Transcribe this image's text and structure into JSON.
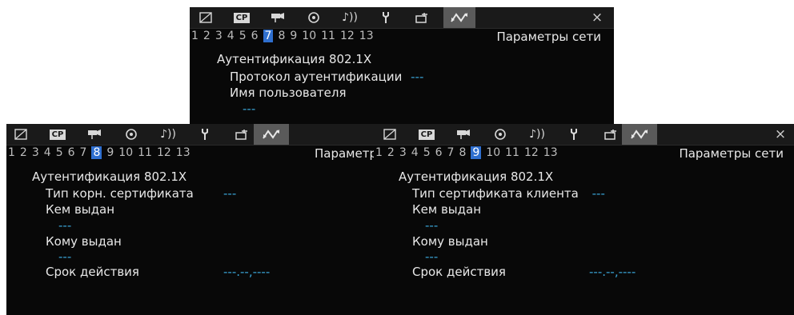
{
  "colors": {
    "background": "#080808",
    "tabbar": "#1a1a1a",
    "active_tab": "#5a5a5a",
    "selected_page": "#2f6fcf",
    "value": "#3aa6d9"
  },
  "tab_icons": [
    "screen-icon",
    "cp-icon",
    "camera-icon",
    "recording-media-icon",
    "audio-icon",
    "wrench-icon",
    "assist-icon",
    "network-icon"
  ],
  "cp_label": "CP",
  "close_symbol": "×",
  "screens": {
    "top": {
      "page_numbers": [
        "1",
        "2",
        "3",
        "4",
        "5",
        "6",
        "7",
        "8",
        "9",
        "10",
        "11",
        "12",
        "13"
      ],
      "selected_page": "7",
      "title": "Параметры сети",
      "heading": "Аутентификация 802.1X",
      "lines": {
        "protocol_label": "Протокол аутентификации",
        "protocol_value": "---",
        "username_label": "Имя пользователя",
        "username_value": "---"
      }
    },
    "left": {
      "page_numbers": [
        "1",
        "2",
        "3",
        "4",
        "5",
        "6",
        "7",
        "8",
        "9",
        "10",
        "11",
        "12",
        "13"
      ],
      "selected_page": "8",
      "title": "Параметр",
      "heading": "Аутентификация 802.1X",
      "lines": {
        "cert_type_label": "Тип корн. сертификата",
        "cert_type_value": "---",
        "issued_by_label": "Кем выдан",
        "issued_by_value": "---",
        "issued_to_label": "Кому выдан",
        "issued_to_value": "---",
        "validity_label": "Срок действия",
        "validity_value": "---.--,----"
      }
    },
    "right": {
      "page_numbers": [
        "1",
        "2",
        "3",
        "4",
        "5",
        "6",
        "7",
        "8",
        "9",
        "10",
        "11",
        "12",
        "13"
      ],
      "selected_page": "9",
      "title": "Параметры сети",
      "heading": "Аутентификация 802.1X",
      "lines": {
        "cert_type_label": "Тип сертификата клиента",
        "cert_type_value": "---",
        "issued_by_label": "Кем выдан",
        "issued_by_value": "---",
        "issued_to_label": "Кому выдан",
        "issued_to_value": "---",
        "validity_label": "Срок действия",
        "validity_value": "---.--,----"
      }
    }
  }
}
